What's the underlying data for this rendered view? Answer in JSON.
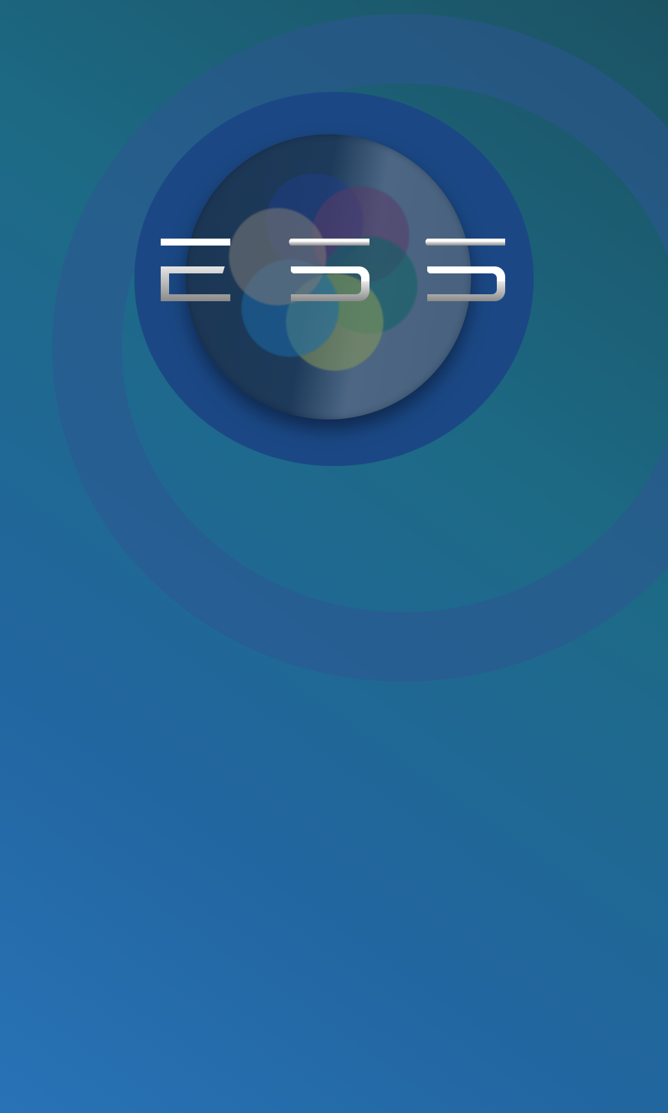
{
  "app": {
    "screen": "splash",
    "logo_text": "ESS"
  },
  "colors": {
    "background_top": "#1b5262",
    "background_bottom": "#2872b6",
    "outer_ring": "#2d5591",
    "middle_disc": "#1b4884",
    "inner_disc_dark": "#1c3654",
    "inner_disc_light": "#4c6684",
    "logo_top": "#ffffff",
    "logo_bottom": "#8a8a8a"
  },
  "petals": [
    {
      "name": "petal-navy",
      "color": "#1f3e86"
    },
    {
      "name": "petal-purple",
      "color": "#5a3b66"
    },
    {
      "name": "petal-teal",
      "color": "#0e6264"
    },
    {
      "name": "petal-olive",
      "color": "#8a9a58"
    },
    {
      "name": "petal-blue",
      "color": "#1a6aa8"
    },
    {
      "name": "petal-gray",
      "color": "#7d7a78"
    }
  ]
}
